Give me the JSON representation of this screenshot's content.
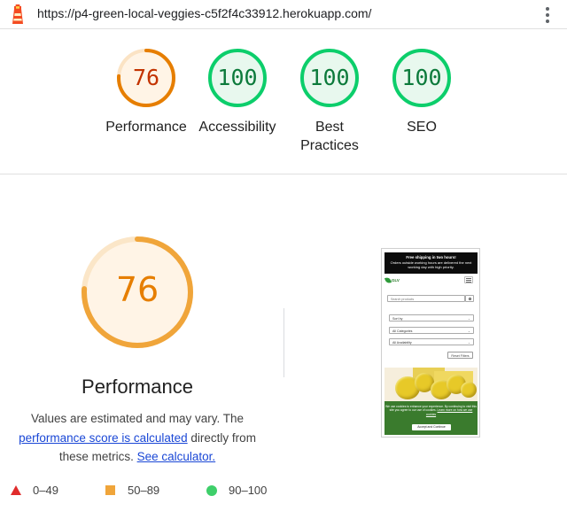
{
  "topbar": {
    "url": "https://p4-green-local-veggies-c5f2f4c33912.herokuapp.com/",
    "logo_icon": "lighthouse-icon",
    "menu_icon": "kebab-menu-icon"
  },
  "summary": {
    "gauges": [
      {
        "label": "Performance",
        "score": "76",
        "status": "average",
        "color": "#e67e00"
      },
      {
        "label": "Accessibility",
        "score": "100",
        "status": "pass",
        "color": "#0c7a3b"
      },
      {
        "label": "Best Practices",
        "score": "100",
        "status": "pass",
        "color": "#0c7a3b"
      },
      {
        "label": "SEO",
        "score": "100",
        "status": "pass",
        "color": "#0c7a3b"
      }
    ]
  },
  "main": {
    "score": "76",
    "score_value": 0.76,
    "title": "Performance",
    "desc_pre": "Values are estimated and may vary. The",
    "desc_link1": "performance score is calculated",
    "desc_mid": "directly from these metrics.",
    "desc_link2": "See calculator."
  },
  "legend": {
    "fail": "0–49",
    "average": "50–89",
    "pass": "90–100"
  },
  "screenshot": {
    "banner_title": "Free shipping in two hours!",
    "banner_text": "Orders outside working hours are delivered the next working day with high priority.",
    "brand": "GLV",
    "search_placeholder": "Search products",
    "sort_label": "Sort by",
    "category_label": "All Categories",
    "availability_label": "All Availability",
    "reset_label": "Reset Filters",
    "cookie_text": "We use cookies to enhance your experience. By continuing to visit this site you agree to our use of cookies.",
    "cookie_link": "Learn more on how we use cookies",
    "accept_label": "Accept and Continue"
  },
  "colors": {
    "average": "#e67e00",
    "average_bg": "#fff4e6",
    "pass": "#0cce6b",
    "pass_bg": "#e8f8ee",
    "link": "#1a47d6"
  }
}
